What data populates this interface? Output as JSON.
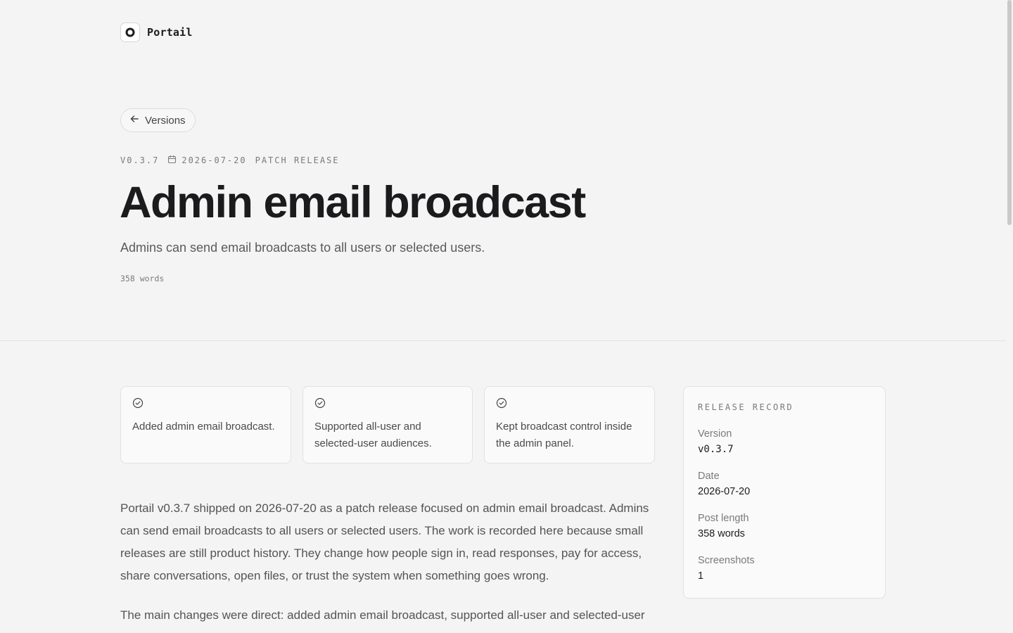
{
  "brand": {
    "name": "Portail"
  },
  "nav": {
    "back_label": "Versions"
  },
  "release": {
    "version_tag": "V0.3.7",
    "date": "2026-07-20",
    "type": "PATCH RELEASE",
    "title": "Admin email broadcast",
    "subtitle": "Admins can send email broadcasts to all users or selected users.",
    "word_count": "358 words"
  },
  "highlights": [
    "Added admin email broadcast.",
    "Supported all-user and selected-user audiences.",
    "Kept broadcast control inside the admin panel."
  ],
  "body": {
    "p1": "Portail v0.3.7 shipped on 2026-07-20 as a patch release focused on admin email broadcast. Admins can send email broadcasts to all users or selected users. The work is recorded here because small releases are still product history. They change how people sign in, read responses, pay for access, share conversations, open files, or trust the system when something goes wrong.",
    "p2": "The main changes were direct: added admin email broadcast, supported all-user and selected-user"
  },
  "record": {
    "title": "RELEASE RECORD",
    "items": [
      {
        "label": "Version",
        "value": "v0.3.7"
      },
      {
        "label": "Date",
        "value": "2026-07-20"
      },
      {
        "label": "Post length",
        "value": "358 words"
      },
      {
        "label": "Screenshots",
        "value": "1"
      }
    ]
  },
  "icons": {
    "logo": "portail-ring-icon",
    "back": "arrow-left-icon",
    "date": "calendar-icon",
    "highlight": "check-circle-icon"
  }
}
